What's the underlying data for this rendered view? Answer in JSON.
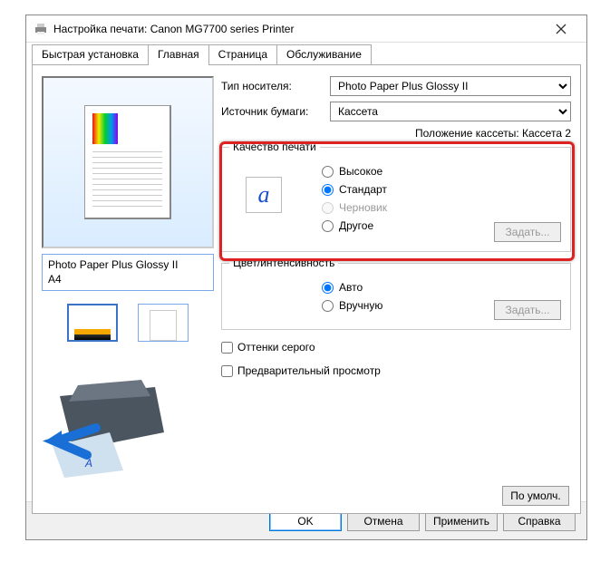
{
  "window": {
    "title": "Настройка печати: Canon MG7700 series Printer"
  },
  "tabs": [
    "Быстрая установка",
    "Главная",
    "Страница",
    "Обслуживание"
  ],
  "active_tab": 1,
  "preview": {
    "media": "Photo Paper Plus Glossy II",
    "size": "A4"
  },
  "form": {
    "media_label": "Тип носителя:",
    "media_value": "Photo Paper Plus Glossy II",
    "source_label": "Источник бумаги:",
    "source_value": "Кассета",
    "cassette_pos": "Положение кассеты: Кассета 2"
  },
  "quality": {
    "legend": "Качество печати",
    "high": "Высокое",
    "standard": "Стандарт",
    "draft": "Черновик",
    "other": "Другое",
    "selected": "standard",
    "set_btn": "Задать..."
  },
  "color": {
    "legend": "Цвет/интенсивность",
    "auto": "Авто",
    "manual": "Вручную",
    "selected": "auto",
    "set_btn": "Задать..."
  },
  "grayscale_label": "Оттенки серого",
  "preview_checkbox_label": "Предварительный просмотр",
  "defaults_btn": "По умолч.",
  "footer": {
    "ok": "OK",
    "cancel": "Отмена",
    "apply": "Применить",
    "help": "Справка"
  }
}
